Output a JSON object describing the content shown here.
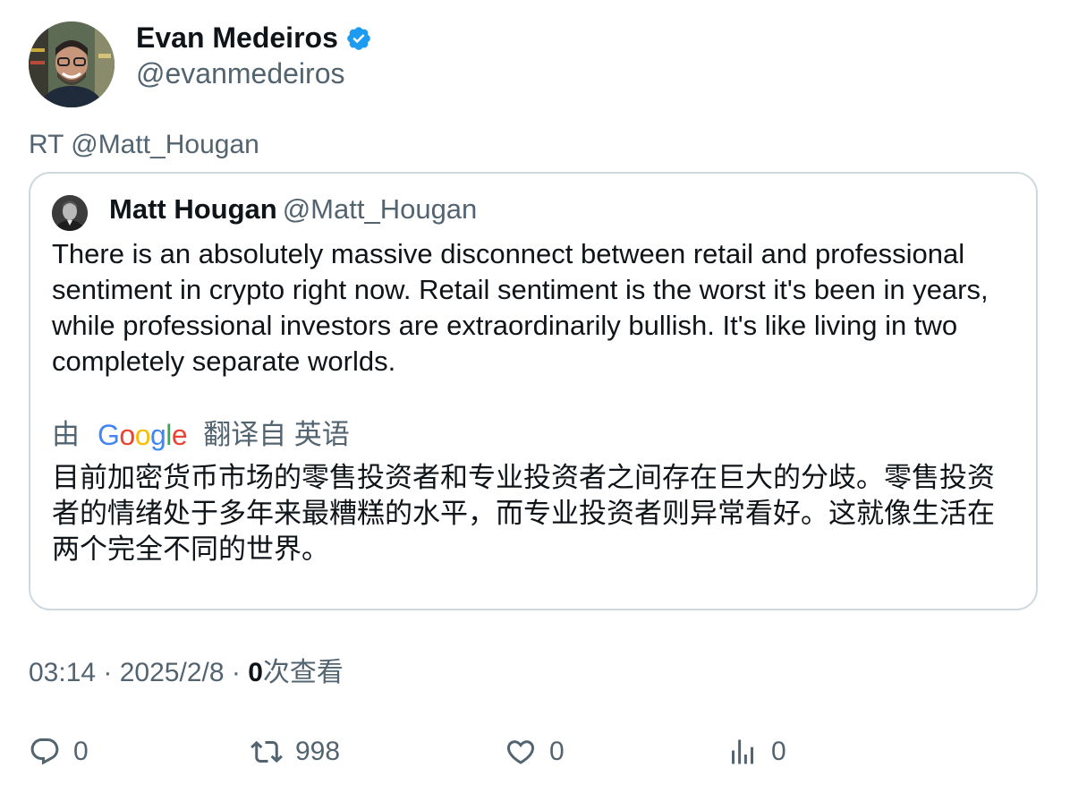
{
  "author": {
    "name": "Evan Medeiros",
    "handle": "@evanmedeiros",
    "verified": true
  },
  "retweet_line": "RT @Matt_Hougan",
  "quoted_tweet": {
    "name": "Matt Hougan",
    "handle": "@Matt_Hougan",
    "text": "There is an absolutely massive disconnect between retail and professional sentiment in crypto right now. Retail sentiment is the worst it's been in years, while professional investors are extraordinarily bullish. It's  like living in two completely separate worlds.",
    "translate_prefix": "由",
    "translate_suffix": "翻译自 英语",
    "translated_text": "目前加密货币市场的零售投资者和专业投资者之间存在巨大的分歧。零售投资者的情绪处于多年来最糟糕的水平，而专业投资者则异常看好。这就像生活在两个完全不同的世界。"
  },
  "meta": {
    "time": "03:14",
    "sep1": " · ",
    "date": "2025/2/8",
    "sep2": " · ",
    "views_count": "0",
    "views_label": "次查看"
  },
  "actions": {
    "reply_count": "0",
    "retweet_count": "998",
    "like_count": "0",
    "views_count": "0"
  },
  "colors": {
    "text_primary": "#0f1419",
    "text_secondary": "#536471",
    "border": "#cfd9de",
    "verified_blue": "#1d9bf0"
  }
}
